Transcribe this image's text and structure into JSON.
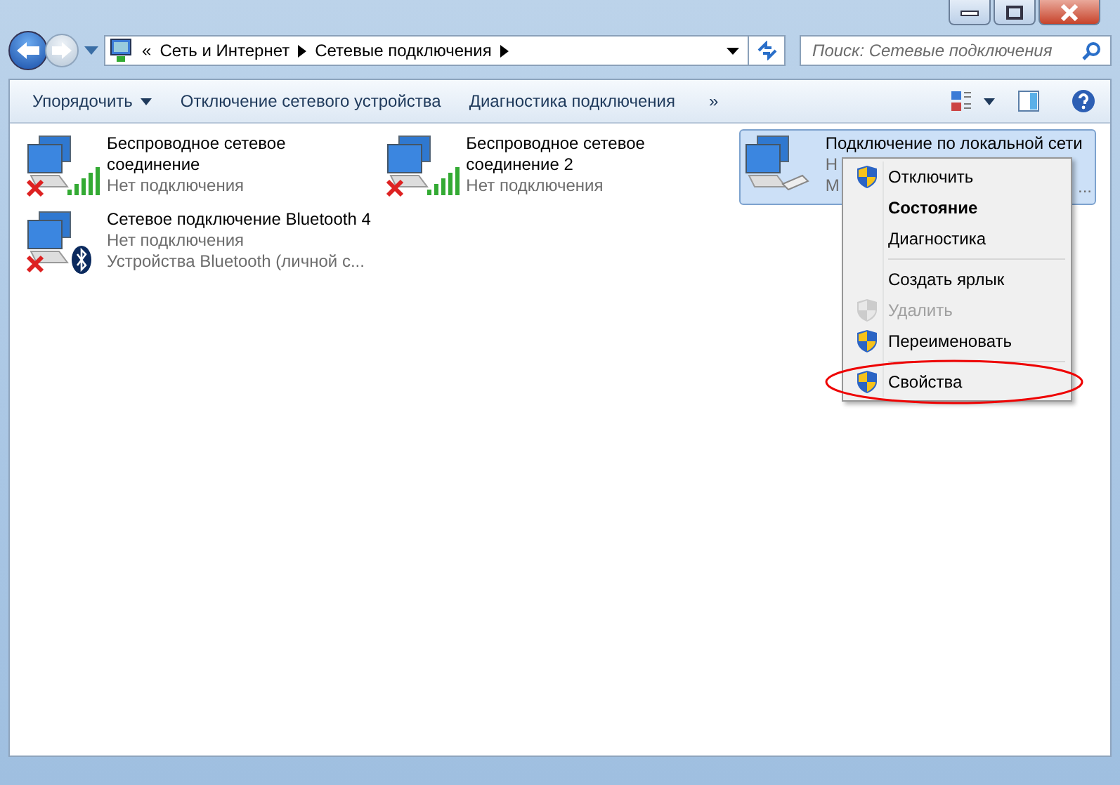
{
  "address_bar": {
    "overflow": "«",
    "crumbs": [
      "Сеть и Интернет",
      "Сетевые подключения"
    ]
  },
  "search": {
    "placeholder": "Поиск: Сетевые подключения"
  },
  "toolbar": {
    "buttons": [
      {
        "label": "Упорядочить",
        "dropdown": true
      },
      {
        "label": "Отключение сетевого устройства",
        "dropdown": false
      },
      {
        "label": "Диагностика подключения",
        "dropdown": false
      }
    ],
    "more": "»"
  },
  "connections": [
    {
      "name_lines": [
        "Беспроводное сетевое",
        "соединение"
      ],
      "details": [
        "Нет подключения"
      ],
      "kind": "wifi",
      "disconnected": true,
      "selected": false
    },
    {
      "name_lines": [
        "Беспроводное сетевое",
        "соединение 2"
      ],
      "details": [
        "Нет подключения"
      ],
      "kind": "wifi",
      "disconnected": true,
      "selected": false
    },
    {
      "name_lines": [
        "Подключение по локальной сети"
      ],
      "details": [
        "Н",
        "М"
      ],
      "tail": "...",
      "kind": "ethernet",
      "disconnected": false,
      "selected": true
    },
    {
      "name_lines": [
        "Сетевое подключение Bluetooth 4"
      ],
      "details": [
        "Нет подключения",
        "Устройства Bluetooth (личной с..."
      ],
      "kind": "bluetooth",
      "disconnected": true,
      "selected": false
    }
  ],
  "context_menu": {
    "items": [
      {
        "kind": "item",
        "label": "Отключить",
        "shield": true,
        "bold": false,
        "disabled": false,
        "circled": false
      },
      {
        "kind": "item",
        "label": "Состояние",
        "shield": false,
        "bold": true,
        "disabled": false,
        "circled": false
      },
      {
        "kind": "item",
        "label": "Диагностика",
        "shield": false,
        "bold": false,
        "disabled": false,
        "circled": false
      },
      {
        "kind": "separator"
      },
      {
        "kind": "item",
        "label": "Создать ярлык",
        "shield": false,
        "bold": false,
        "disabled": false,
        "circled": false
      },
      {
        "kind": "item",
        "label": "Удалить",
        "shield": true,
        "bold": false,
        "disabled": true,
        "circled": false
      },
      {
        "kind": "item",
        "label": "Переименовать",
        "shield": true,
        "bold": false,
        "disabled": false,
        "circled": false
      },
      {
        "kind": "separator"
      },
      {
        "kind": "item",
        "label": "Свойства",
        "shield": true,
        "bold": false,
        "disabled": false,
        "circled": true
      }
    ]
  }
}
